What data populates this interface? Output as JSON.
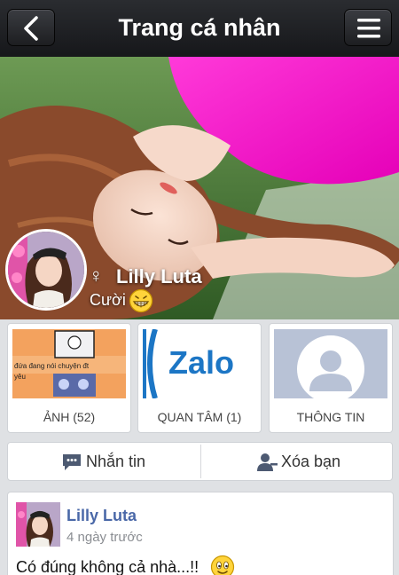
{
  "header": {
    "title": "Trang cá nhân",
    "back_icon": "chevron-left-icon",
    "menu_icon": "hamburger-menu-icon"
  },
  "profile": {
    "name": "Lilly Luta",
    "status": "Cười",
    "gender_icon": "female-icon",
    "status_emoji": "grin-emoji-icon"
  },
  "tiles": [
    {
      "label": "ẢNH (52)",
      "thumb_caption_line1": "đứa đang nói chuyện đt",
      "thumb_caption_line2": "yêu"
    },
    {
      "label": "QUAN TÂM (1)",
      "thumb_text": "Zalo"
    },
    {
      "label": "THÔNG TIN"
    }
  ],
  "actions": {
    "message_label": "Nhắn tin",
    "unfriend_label": "Xóa bạn",
    "message_icon": "chat-bubble-icon",
    "unfriend_icon": "remove-person-icon"
  },
  "feed": {
    "posts": [
      {
        "author": "Lilly Luta",
        "time": "4 ngày trước",
        "text": "Có đúng không cả nhà...!!"
      }
    ]
  },
  "colors": {
    "header_bg": "#1f2024",
    "link_blue": "#4a68a8",
    "zalo_blue": "#1c76c5",
    "page_bg": "#dfe1e4"
  }
}
